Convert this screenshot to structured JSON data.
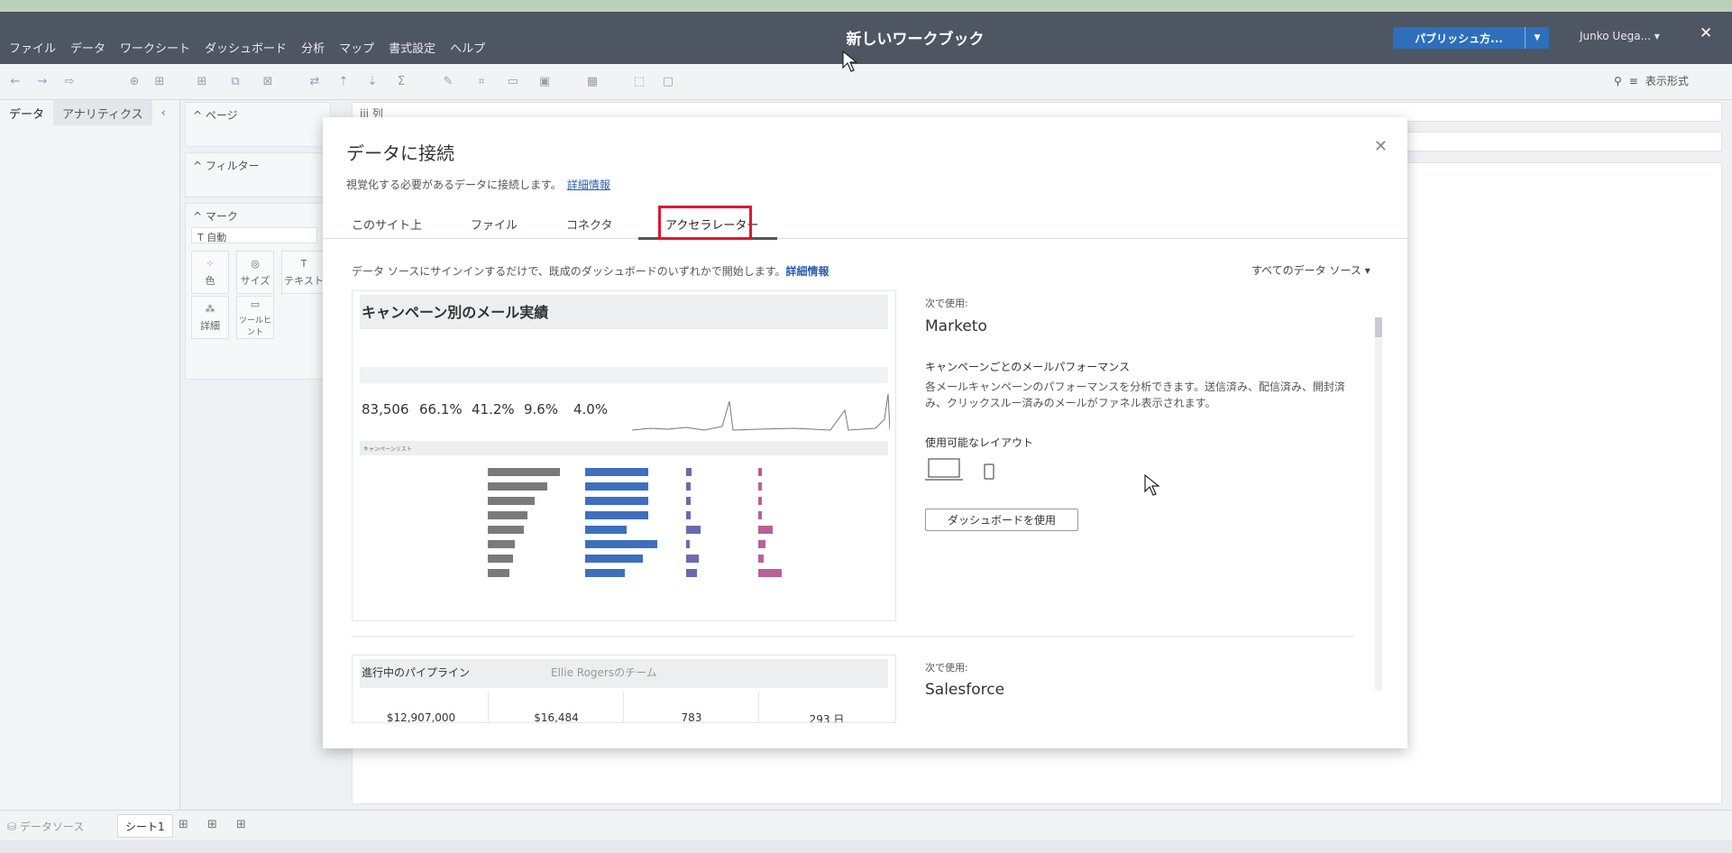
{
  "app": {
    "menu": [
      "ファイル",
      "データ",
      "ワークシート",
      "ダッシュボード",
      "分析",
      "マップ",
      "書式設定",
      "ヘルプ"
    ],
    "workbook_title": "新しいワークブック",
    "publish_label": "パブリッシュ方...",
    "user_name": "Junko Uega...",
    "show_format_label": "表示形式"
  },
  "panes": {
    "data_tab": "データ",
    "analytics_tab": "アナリティクス",
    "pages_label": "^ ページ",
    "filters_label": "^ フィルター",
    "marks_label": "^ マーク",
    "mark_type": "自動",
    "mark_buttons": [
      "色",
      "サイズ",
      "テキスト",
      "詳細",
      "ツールヒント"
    ],
    "columns_label": "iii 列"
  },
  "bottom": {
    "datasource_tab": "データソース",
    "sheet_tab": "シート1"
  },
  "modal": {
    "title": "データに接続",
    "subtitle": "視覚化する必要があるデータに接続します。",
    "subtitle_link": "詳細情報",
    "tabs": [
      "このサイト上",
      "ファイル",
      "コネクタ",
      "アクセラレーター"
    ],
    "active_tab": "アクセラレーター",
    "description": "データ ソースにサインインするだけで、既成のダッシュボードのいずれかで開始します。",
    "description_link": "詳細情報",
    "filter_label": "すべてのデータ ソース",
    "accelerators": [
      {
        "preview_title": "キャンペーン別のメール実績",
        "kpis": [
          "83,506",
          "66.1%",
          "41.2%",
          "9.6%",
          "4.0%"
        ],
        "list_title": "キャンペーンリスト",
        "use_with_label": "次で使用:",
        "source": "Marketo",
        "heading": "キャンペーンごとのメールパフォーマンス",
        "description": "各メールキャンペーンのパフォーマンスを分析できます。送信済み、配信済み、開封済み、クリックスルー済みのメールがファネル表示されます。",
        "layouts_label": "使用可能なレイアウト",
        "use_button": "ダッシュボードを使用"
      },
      {
        "preview_title": "進行中のパイプライン",
        "preview_subtitle": "Ellie Rogersのチーム",
        "kpis": [
          "$12,907,000",
          "$16,484",
          "783",
          "293 日"
        ],
        "use_with_label": "次で使用:",
        "source": "Salesforce"
      }
    ]
  }
}
